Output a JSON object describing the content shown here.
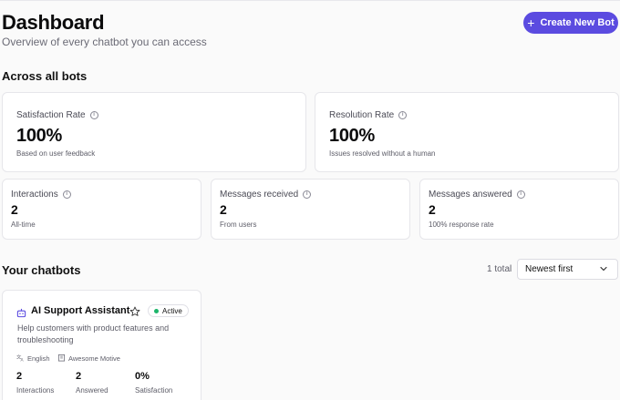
{
  "header": {
    "title": "Dashboard",
    "subtitle": "Overview of every chatbot you can access",
    "create_button": "Create New Bot"
  },
  "overview": {
    "section_title": "Across all bots",
    "satisfaction": {
      "label": "Satisfaction Rate",
      "value": "100%",
      "note": "Based on user feedback"
    },
    "resolution": {
      "label": "Resolution Rate",
      "value": "100%",
      "note": "Issues resolved without a human"
    },
    "interactions": {
      "label": "Interactions",
      "value": "2",
      "note": "All-time"
    },
    "messages_received": {
      "label": "Messages received",
      "value": "2",
      "note": "From users"
    },
    "messages_answered": {
      "label": "Messages answered",
      "value": "2",
      "note": "100% response rate"
    }
  },
  "chatbots": {
    "section_title": "Your chatbots",
    "total": "1 total",
    "sort_selected": "Newest first",
    "items": [
      {
        "name": "AI Support Assistant",
        "status": "Active",
        "description": "Help customers with product features and troubleshooting",
        "language": "English",
        "workspace": "Awesome Motive",
        "stats": [
          {
            "value": "2",
            "label": "Interactions"
          },
          {
            "value": "2",
            "label": "Answered"
          },
          {
            "value": "0%",
            "label": "Satisfaction"
          }
        ]
      }
    ]
  },
  "colors": {
    "accent": "#5b4be0",
    "active_dot": "#1db56b",
    "bot_icon": "#5b4be0"
  },
  "icons": {
    "create": "plus-icon",
    "info": "info-icon",
    "sort": "chevron-down-icon",
    "bot": "bot-icon",
    "favorite": "star-icon",
    "language": "translate-icon",
    "workspace": "building-icon"
  }
}
